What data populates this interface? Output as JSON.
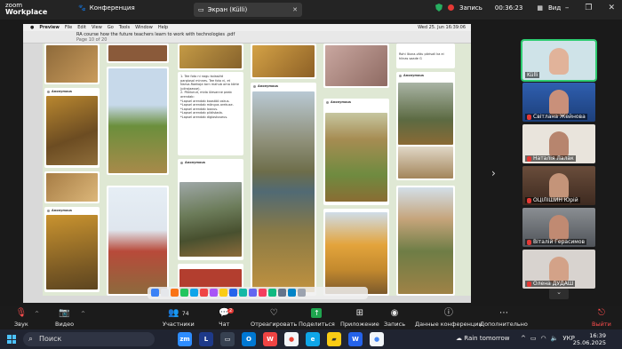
{
  "titlebar": {
    "brand_line1": "zoom",
    "brand_line2": "Workplace",
    "conference_label": "Конференция",
    "share_tab_label": "Экран (Külli)",
    "record_label": "Запись",
    "timer": "00:36:23",
    "view_label": "Вид"
  },
  "shared": {
    "mac_menu": [
      "Preview",
      "File",
      "Edit",
      "View",
      "Go",
      "Tools",
      "Window",
      "Help"
    ],
    "mac_clock": "Wed 25. Jun  16:39:06",
    "pdf_title": "RA course how the future teachers learn to work with technologies .pdf",
    "pdf_page": "Page 10 of 20",
    "post_author": "Anonymous",
    "post_text_1": "1. Tee foto ni nagu kolaažid\npargiosal minnes. Tee foto ni, et\nNarva-Raekoja torn mahub oma kõrte\n(piirajaasse).\n2. Põldurud, mida ülesanne peab\narendab:\n*Lapsel arendab koostöö oskus.\n*Lapsel arendab mängus orekuse.\n*Lapsel arendab loovus.\n*Lapsel arendab pildistada.\n*Lapsel arendab digioskuseus.",
    "post_text_2": "Rohi lõuna-võtu pärisali ka ei\nhiinas saade G"
  },
  "participants": [
    {
      "name": "Külli",
      "muted": false,
      "bg": "#cfe3e8",
      "skin": "#e1b39a"
    },
    {
      "name": "Світлана Жейнова",
      "muted": true,
      "bg": "#2f5fb0",
      "skin": "#c9907a"
    },
    {
      "name": "Наталія Лалак",
      "muted": true,
      "bg": "#e9e4dc",
      "skin": "#b7856e"
    },
    {
      "name": "ОЦІЛІШИН Юрій",
      "muted": true,
      "bg": "#5a3f30",
      "skin": "#c49479"
    },
    {
      "name": "Віталій Герасимов",
      "muted": true,
      "bg": "#6a6e73",
      "skin": "#c08a72"
    },
    {
      "name": "Олена ДУДАШ",
      "muted": true,
      "bg": "#d8d3cf",
      "skin": "#d3a288"
    }
  ],
  "toolbar": {
    "audio": "Звук",
    "video": "Видео",
    "participants": "Участники",
    "participants_count": "74",
    "chat": "Чат",
    "chat_badge": "2",
    "react": "Отреагировать",
    "share": "Поделиться",
    "apps": "Приложение",
    "record": "Запись",
    "conf_data": "Данные конференции",
    "more": "Дополнительно",
    "leave": "Выйти"
  },
  "taskbar": {
    "search_placeholder": "Поиск",
    "weather": "Rain tomorrow",
    "lang": "УКР",
    "time": "16:39",
    "date": "25.06.2025"
  },
  "colors": {
    "accent_green": "#1fa54f",
    "record_red": "#e53935",
    "taskbar_bg": "#202431",
    "zoom_bg": "#1b1b1b"
  }
}
